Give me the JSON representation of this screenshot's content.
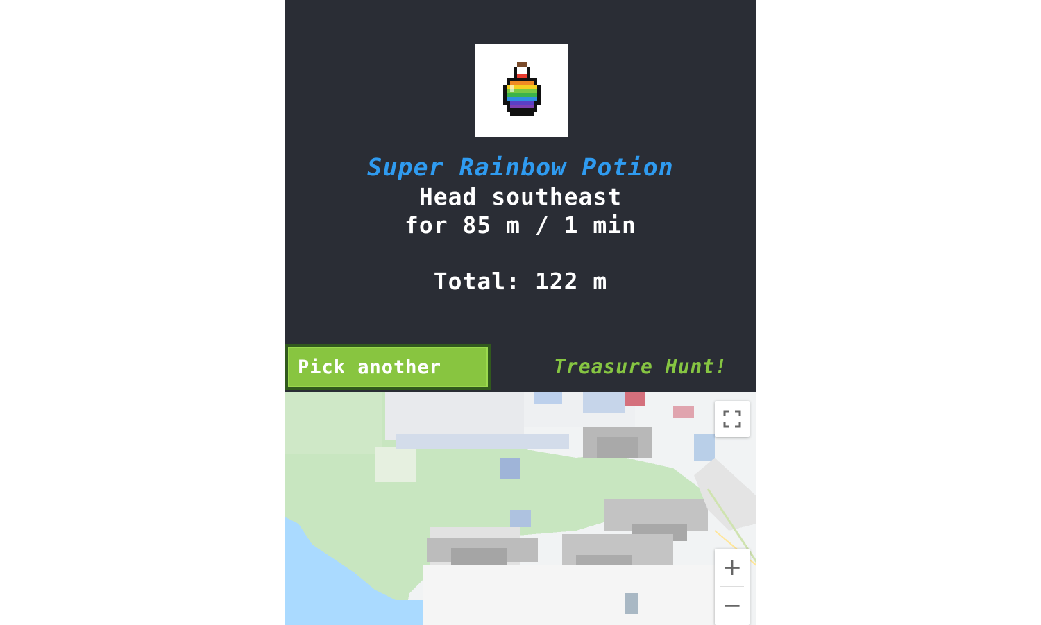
{
  "item": {
    "name": "Super Rainbow Potion",
    "icon": "rainbow-potion-icon"
  },
  "directions": {
    "line1": "Head southeast",
    "line2": "for 85 m / 1 min",
    "total": "Total: 122 m"
  },
  "buttons": {
    "pick_another": "Pick another"
  },
  "app": {
    "title": "Treasure Hunt!"
  },
  "map": {
    "controls": {
      "fullscreen_icon": "fullscreen-icon",
      "zoom_in": "+",
      "zoom_out": "−"
    }
  },
  "colors": {
    "panel_bg": "#2a2d35",
    "item_name": "#2f9bf0",
    "button_green": "#88c540",
    "title_green": "#86c542"
  }
}
